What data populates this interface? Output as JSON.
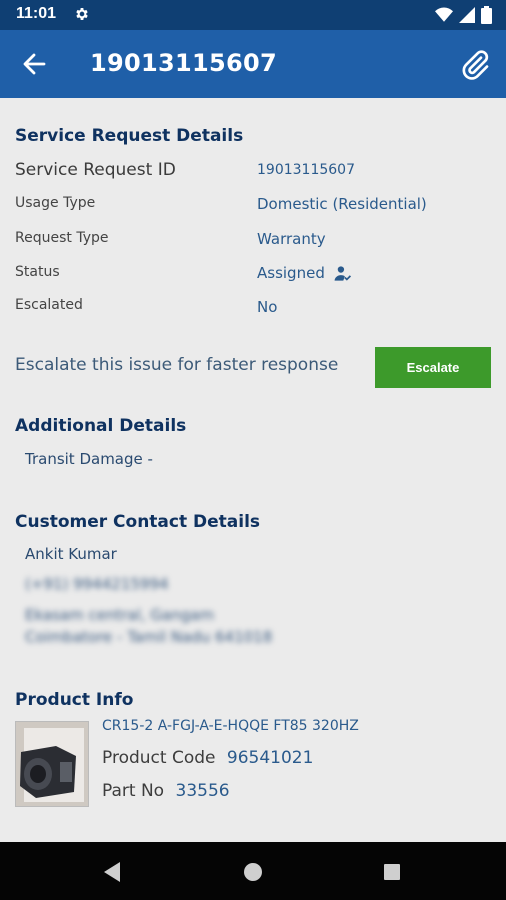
{
  "status_bar": {
    "time": "11:01"
  },
  "app_bar": {
    "title": "19013115607"
  },
  "service_request": {
    "title": "Service Request Details",
    "rows": [
      {
        "label": "Service Request ID",
        "value": "19013115607"
      },
      {
        "label": "Usage Type",
        "value": "Domestic (Residential)"
      },
      {
        "label": "Request Type",
        "value": "Warranty"
      },
      {
        "label": "Status",
        "value": "Assigned"
      },
      {
        "label": "Escalated",
        "value": "No"
      }
    ]
  },
  "escalate": {
    "text": "Escalate this issue for faster response",
    "button_label": "Escalate"
  },
  "additional": {
    "title": "Additional Details",
    "text": "Transit Damage -"
  },
  "customer": {
    "title": "Customer Contact Details",
    "name": "Ankit Kumar",
    "phone": "(+91) 9944215994",
    "address_line1": "Ekasam central, Gangam",
    "address_line2": "Coimbatore - Tamil Nadu 641018"
  },
  "product": {
    "title": "Product Info",
    "name": "CR15-2 A-FGJ-A-E-HQQE FT85 320HZ",
    "code_label": "Product Code",
    "code_value": "96541021",
    "part_label": "Part No",
    "part_value": "33556"
  },
  "colors": {
    "primary": "#1f5fa8",
    "status_bar": "#0f3f73",
    "accent_green": "#3d9a2b",
    "heading": "#0f3260"
  }
}
